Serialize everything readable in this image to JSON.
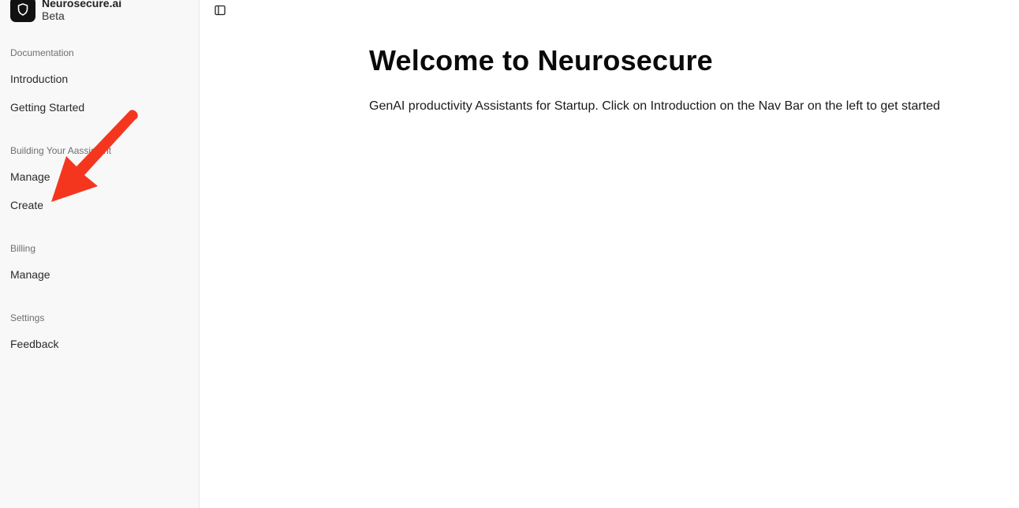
{
  "brand": {
    "name": "Neurosecure.ai",
    "badge": "Beta",
    "logo_icon": "shield-icon"
  },
  "sidebar": {
    "groups": [
      {
        "label": "Documentation",
        "items": [
          {
            "label": "Introduction"
          },
          {
            "label": "Getting Started"
          }
        ]
      },
      {
        "label": "Building Your Aassistant",
        "items": [
          {
            "label": "Manage"
          },
          {
            "label": "Create"
          }
        ]
      },
      {
        "label": "Billing",
        "items": [
          {
            "label": "Manage"
          }
        ]
      },
      {
        "label": "Settings",
        "items": [
          {
            "label": "Feedback"
          }
        ]
      }
    ]
  },
  "toolbar": {
    "toggle_icon": "sidebar-toggle-icon"
  },
  "main": {
    "title": "Welcome to Neurosecure",
    "description": "GenAI productivity Assistants for Startup. Click on Introduction on the Nav Bar on the left to get started"
  },
  "annotation": {
    "arrow_color": "#f5361f"
  },
  "colors": {
    "sidebar_bg": "#f8f8f8",
    "logo_bg": "#111111"
  }
}
